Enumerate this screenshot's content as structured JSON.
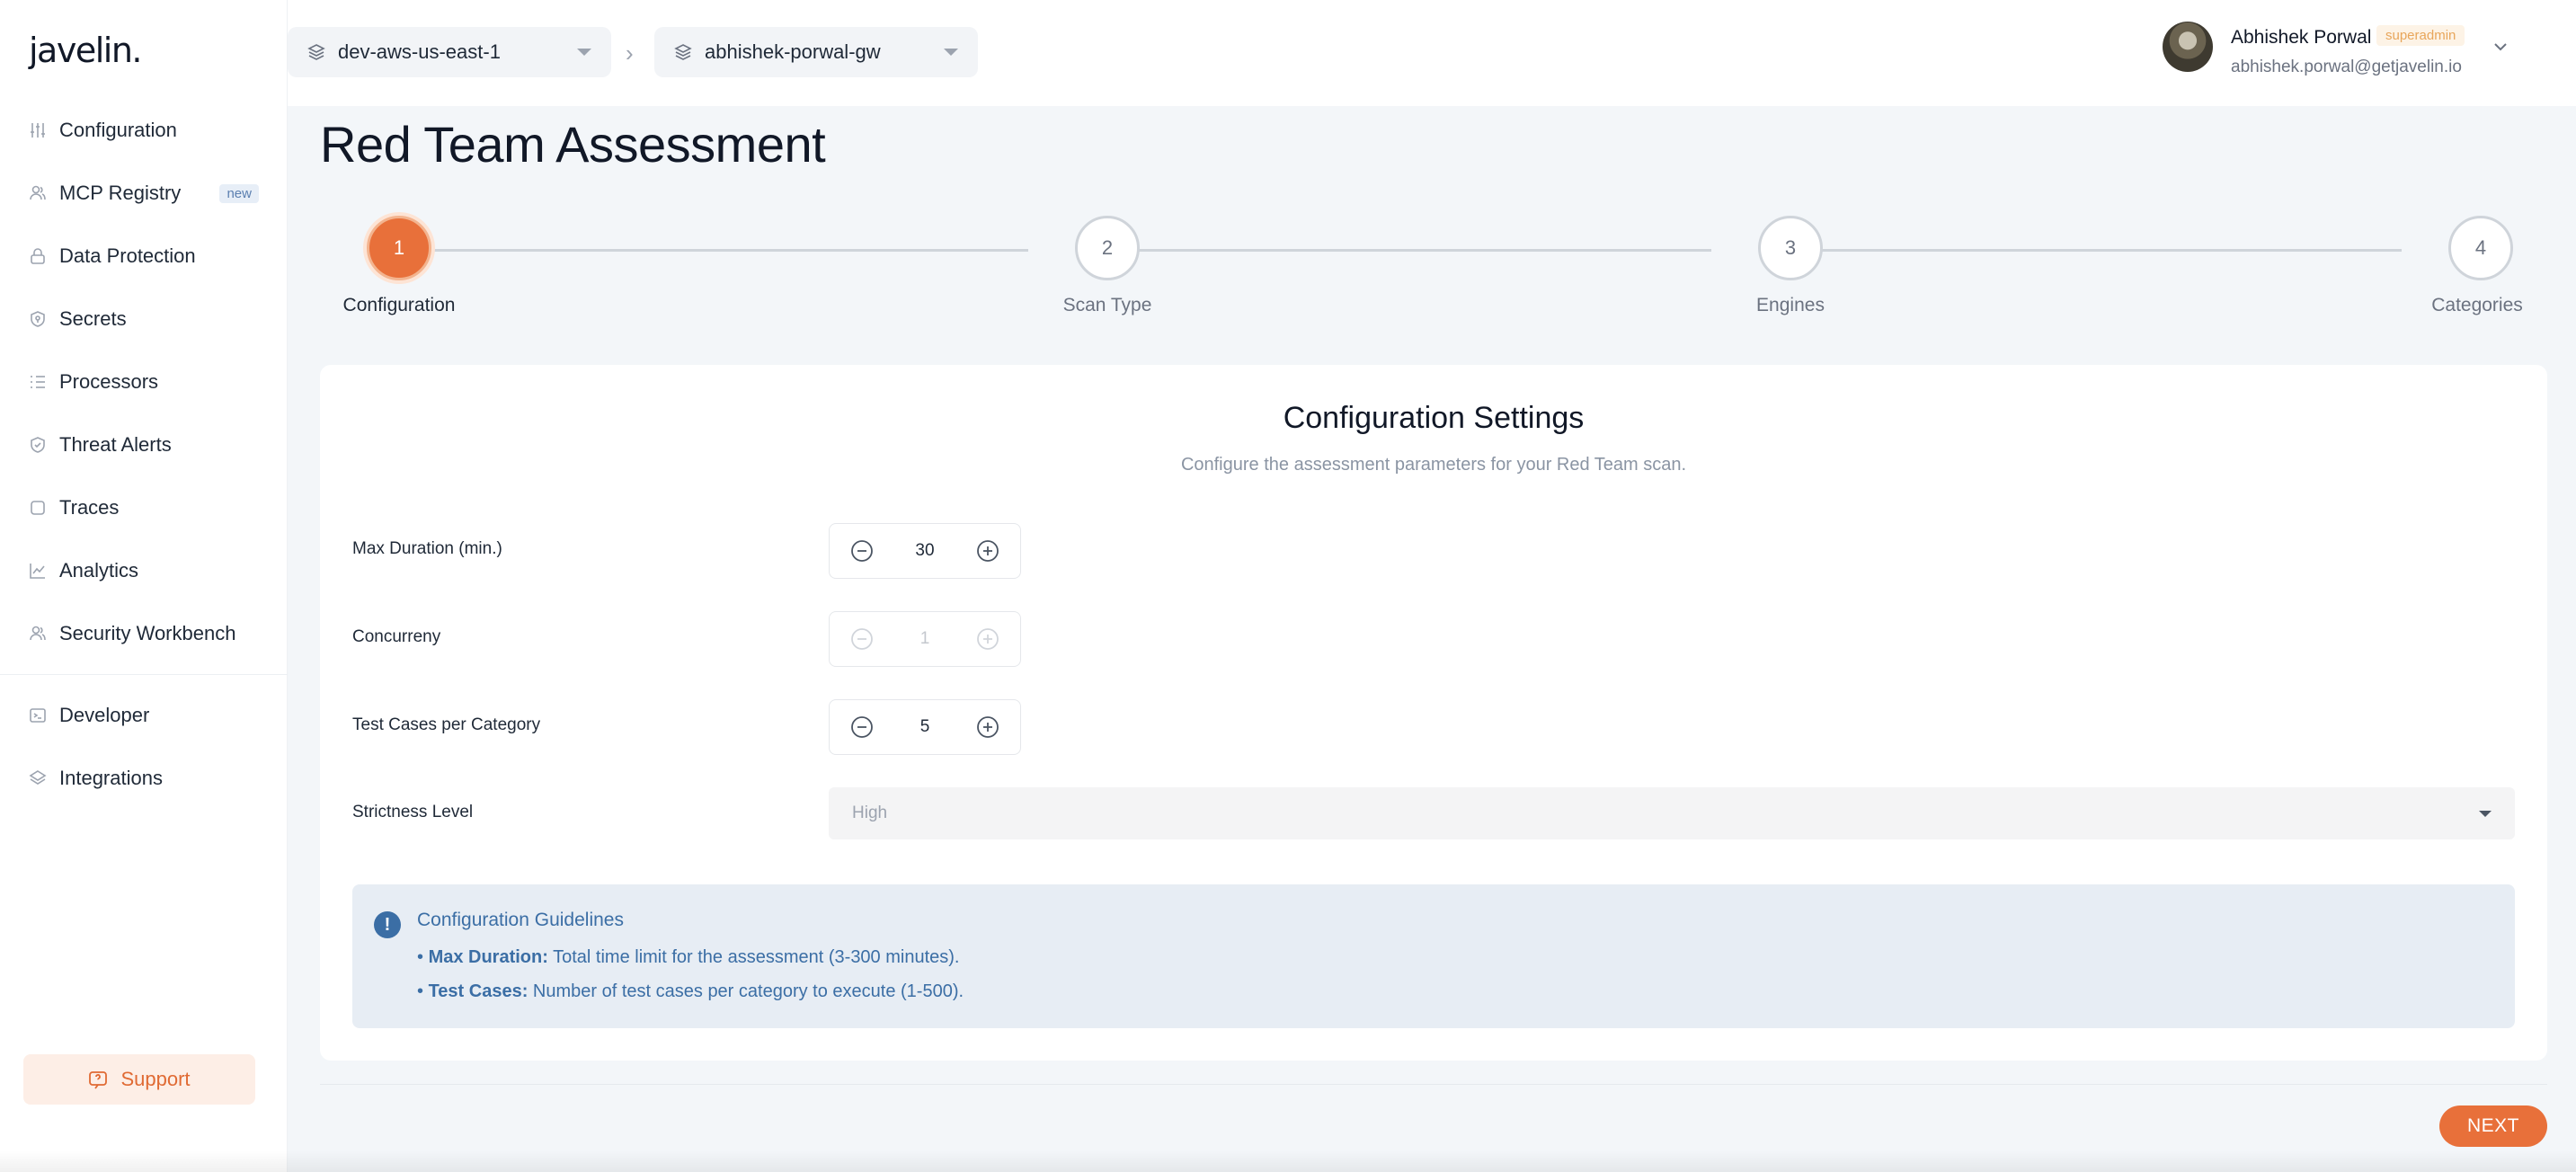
{
  "brand": {
    "logo": "javelin."
  },
  "sidebar": {
    "items": [
      {
        "label": "Configuration",
        "icon": "sliders-icon"
      },
      {
        "label": "MCP Registry",
        "icon": "users-icon",
        "badge": "new"
      },
      {
        "label": "Data Protection",
        "icon": "lock-icon"
      },
      {
        "label": "Secrets",
        "icon": "shield-key-icon"
      },
      {
        "label": "Processors",
        "icon": "list-icon"
      },
      {
        "label": "Threat Alerts",
        "icon": "shield-check-icon"
      },
      {
        "label": "Traces",
        "icon": "square-icon"
      },
      {
        "label": "Analytics",
        "icon": "chart-icon"
      },
      {
        "label": "Security Workbench",
        "icon": "users-icon"
      }
    ],
    "secondary_items": [
      {
        "label": "Developer",
        "icon": "terminal-icon"
      },
      {
        "label": "Integrations",
        "icon": "stack-icon"
      }
    ],
    "support_label": "Support"
  },
  "header": {
    "environment": "dev-aws-us-east-1",
    "gateway": "abhishek-porwal-gw",
    "user": {
      "name": "Abhishek Porwal",
      "role": "superadmin",
      "email": "abhishek.porwal@getjavelin.io"
    }
  },
  "main": {
    "title": "Red Team Assessment",
    "steps": [
      {
        "number": "1",
        "label": "Configuration",
        "active": true
      },
      {
        "number": "2",
        "label": "Scan Type",
        "active": false
      },
      {
        "number": "3",
        "label": "Engines",
        "active": false
      },
      {
        "number": "4",
        "label": "Categories",
        "active": false
      }
    ],
    "settings": {
      "title": "Configuration Settings",
      "subtitle": "Configure the assessment parameters for your Red Team scan.",
      "max_duration": {
        "label": "Max Duration (min.)",
        "value": "30"
      },
      "concurrency": {
        "label": "Concurreny",
        "value": "1",
        "disabled": true
      },
      "test_cases": {
        "label": "Test Cases per Category",
        "value": "5"
      },
      "strictness": {
        "label": "Strictness Level",
        "value": "High"
      }
    },
    "guidelines": {
      "title": "Configuration Guidelines",
      "max_duration_key": "Max Duration:",
      "max_duration_text": " Total time limit for the assessment (3-300 minutes).",
      "test_cases_key": "Test Cases:",
      "test_cases_text": " Number of test cases per category to execute (1-500)."
    },
    "next_label": "NEXT"
  },
  "colors": {
    "accent": "#e8703a",
    "info": "#3b6ea5"
  }
}
